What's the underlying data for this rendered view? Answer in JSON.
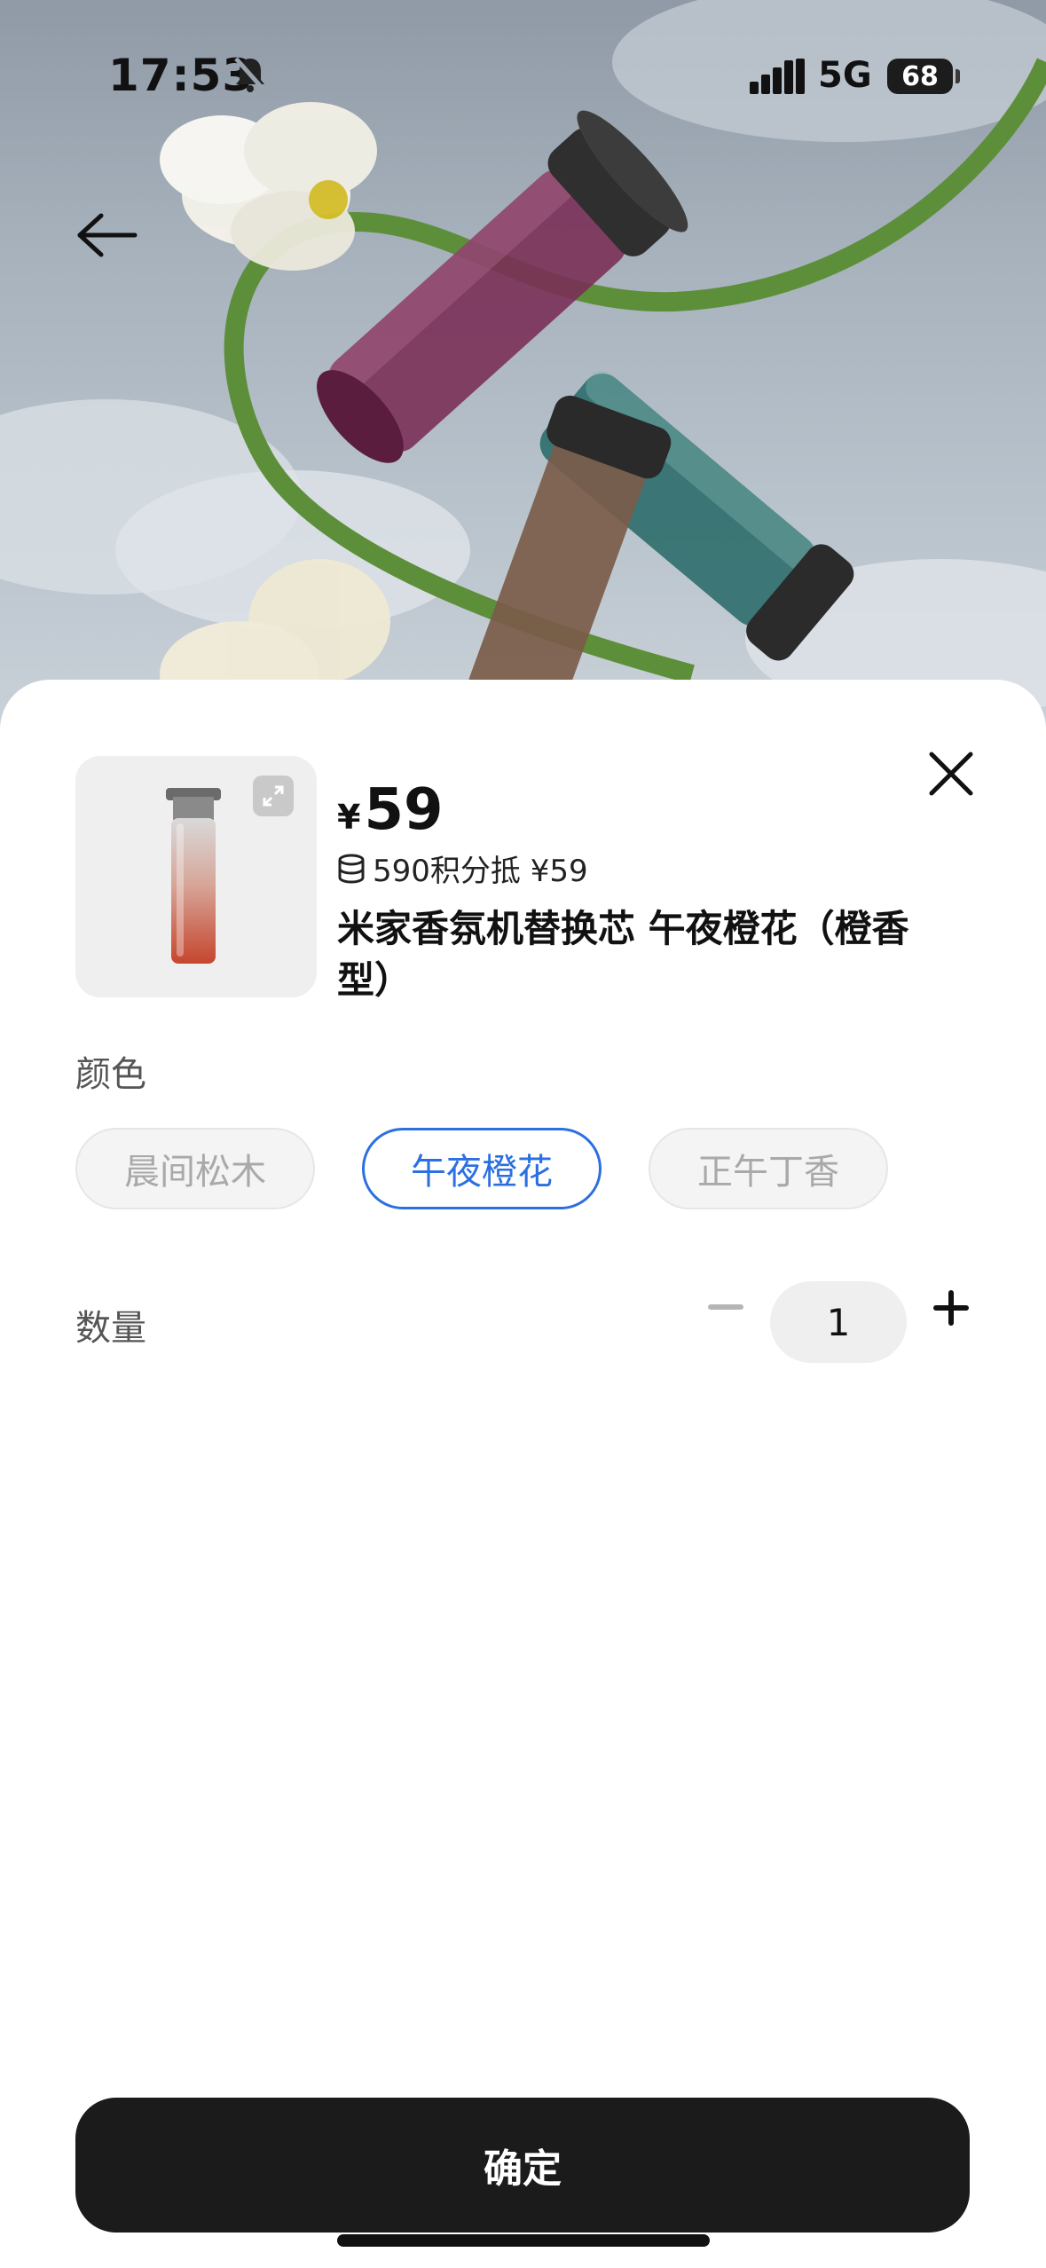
{
  "status_bar": {
    "time": "17:53",
    "network": "5G",
    "battery": "68",
    "icons": [
      "bell-slash-icon",
      "signal-bars-icon",
      "battery-icon"
    ]
  },
  "header": {
    "back_icon": "arrow-left-icon"
  },
  "product": {
    "price_symbol": "¥",
    "price": "59",
    "points_text": "590积分抵 ¥59",
    "title": "米家香氛机替换芯 午夜橙花（橙香型）",
    "thumb_icon": "expand-icon"
  },
  "color_section": {
    "label": "颜色",
    "options": [
      {
        "label": "晨间松木",
        "state": "disabled"
      },
      {
        "label": "午夜橙花",
        "state": "selected"
      },
      {
        "label": "正午丁香",
        "state": "disabled"
      }
    ],
    "selected_color": "#2b6fe0"
  },
  "quantity_section": {
    "label": "数量",
    "value": "1",
    "minus_icon": "minus-icon",
    "plus_icon": "plus-icon"
  },
  "confirm_label": "确定",
  "close_icon": "close-icon"
}
